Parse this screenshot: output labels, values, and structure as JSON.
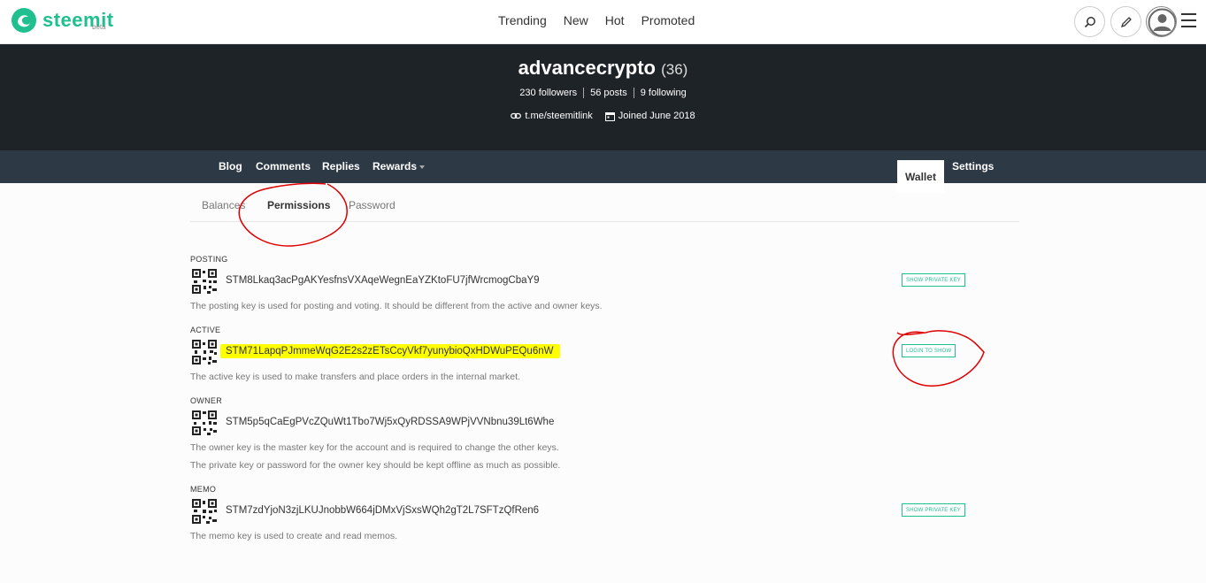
{
  "brand": {
    "name": "steemit",
    "tag": "beta",
    "color": "#1fbf8f"
  },
  "topnav": {
    "items": [
      "Trending",
      "New",
      "Hot",
      "Promoted"
    ]
  },
  "header_icons": [
    "search-icon",
    "pencil-icon",
    "user-icon",
    "hamburger-icon"
  ],
  "profile": {
    "username": "advancecrypto",
    "reputation": "(36)",
    "followers": "230 followers",
    "posts": "56 posts",
    "following": "9 following",
    "link": "t.me/steemitlink",
    "joined": "Joined June 2018"
  },
  "subnav": {
    "blog": "Blog",
    "comments": "Comments",
    "replies": "Replies",
    "rewards": "Rewards",
    "wallet": "Wallet",
    "settings": "Settings"
  },
  "wallet_tabs": {
    "balances": "Balances",
    "permissions": "Permissions",
    "password": "Password",
    "active": "Permissions"
  },
  "keys": {
    "posting": {
      "label": "POSTING",
      "public_key": "STM8Lkaq3acPgAKYesfnsVXAqeWegnEaYZKtoFU7jfWrcmogCbaY9",
      "description": "The posting key is used for posting and voting. It should be different from the active and owner keys.",
      "button": "SHOW PRIVATE KEY"
    },
    "active": {
      "label": "ACTIVE",
      "public_key": "STM71LapqPJmmeWqG2E2s2zETsCcyVkf7yunybioQxHDWuPEQu6nW",
      "description": "The active key is used to make transfers and place orders in the internal market.",
      "button": "LOGIN TO SHOW",
      "highlight_color": "#ffff00"
    },
    "owner": {
      "label": "OWNER",
      "public_key": "STM5p5qCaEgPVcZQuWt1Tbo7Wj5xQyRDSSA9WPjVVNbnu39Lt6Whe",
      "description": "The owner key is the master key for the account and is required to change the other keys.",
      "description2": "The private key or password for the owner key should be kept offline as much as possible."
    },
    "memo": {
      "label": "MEMO",
      "public_key": "STM7zdYjoN3zjLKUJnobbW664jDMxVjSxsWQh2gT2L7SFTzQfRen6",
      "description": "The memo key is used to create and read memos.",
      "button": "SHOW PRIVATE KEY"
    }
  },
  "colors": {
    "banner": "#1e2328",
    "subnav": "#2d3945",
    "annotation": "#e00000",
    "accent": "#1fbf8f"
  }
}
